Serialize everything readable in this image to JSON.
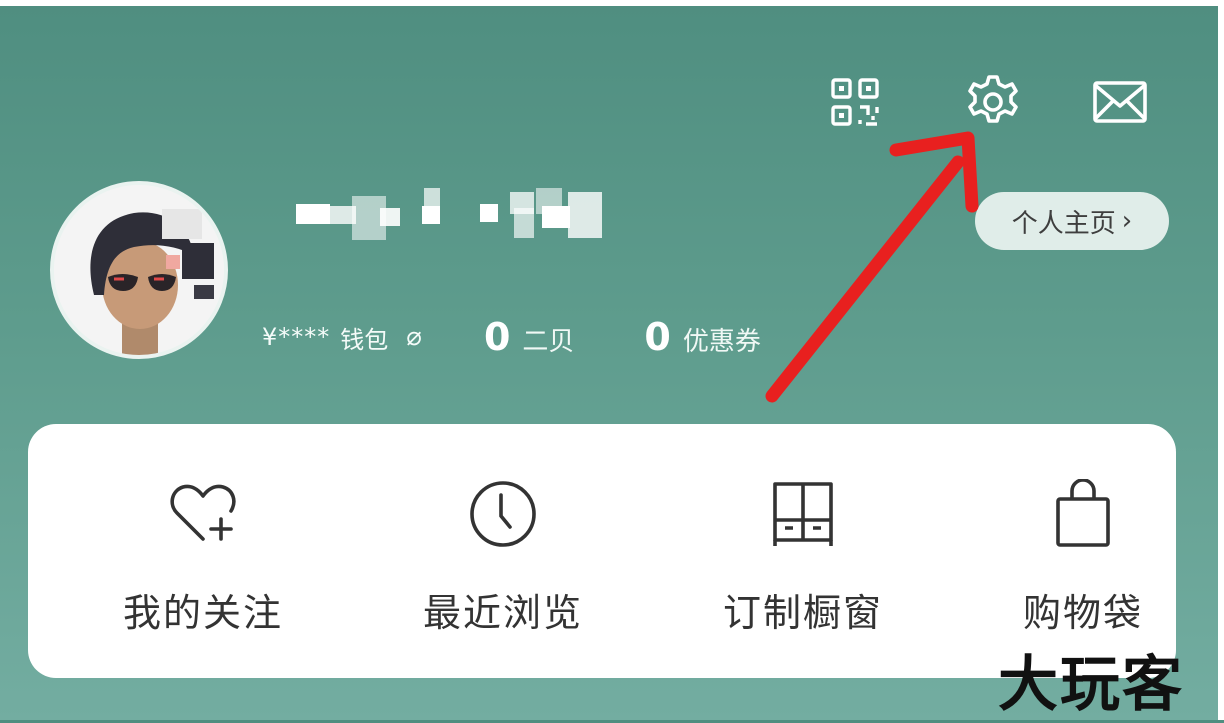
{
  "header": {
    "icons": [
      "qr-code-icon",
      "settings-gear-icon",
      "mail-icon"
    ]
  },
  "profile": {
    "avatar": "avatar",
    "homepage_label": "个人主页",
    "homepage_chevron": "›"
  },
  "stats": {
    "wallet_amount": "¥****",
    "wallet_label": "钱包",
    "hide_icon": "⌀",
    "second_count": "0",
    "second_label": "二贝",
    "coupons_count": "0",
    "coupons_label": "优惠券"
  },
  "menu": {
    "items": [
      {
        "label": "我的关注",
        "icon": "heart-plus-icon"
      },
      {
        "label": "最近浏览",
        "icon": "clock-icon"
      },
      {
        "label": "订制橱窗",
        "icon": "cabinet-icon"
      },
      {
        "label": "购物袋",
        "icon": "shopping-bag-icon"
      }
    ]
  },
  "watermark": "大玩客",
  "colors": {
    "header_bg_top": "#4f8e80",
    "header_bg_bottom": "#73ada1",
    "card_bg": "#ffffff",
    "arrow": "#e8201f"
  }
}
